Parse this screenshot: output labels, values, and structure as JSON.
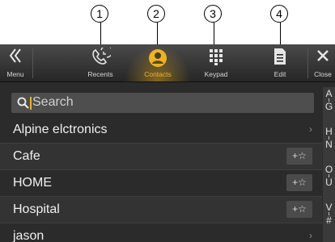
{
  "callouts": [
    "1",
    "2",
    "3",
    "4"
  ],
  "tabs": {
    "menu": {
      "label": "Menu",
      "icon": "double-chevron-left-icon"
    },
    "recents": {
      "label": "Recents",
      "icon": "phone-recents-icon"
    },
    "contacts": {
      "label": "Contacts",
      "icon": "contact-person-icon"
    },
    "keypad": {
      "label": "Keypad",
      "icon": "keypad-icon"
    },
    "edit": {
      "label": "Edit",
      "icon": "document-edit-icon"
    },
    "close": {
      "label": "Close",
      "icon": "close-x-icon"
    }
  },
  "search": {
    "placeholder": "Search"
  },
  "contacts": [
    {
      "name": "Alpine elctronics",
      "action": "›"
    },
    {
      "name": "Cafe",
      "action": "+☆"
    },
    {
      "name": "HOME",
      "action": "+☆"
    },
    {
      "name": "Hospital",
      "action": "+☆"
    },
    {
      "name": "jason",
      "action": "›"
    }
  ],
  "index": [
    {
      "top": "A",
      "bottom": "G"
    },
    {
      "top": "H",
      "bottom": "N"
    },
    {
      "top": "O",
      "bottom": "U"
    },
    {
      "top": "V",
      "bottom": "#"
    }
  ],
  "colors": {
    "accent": "#f1b21a",
    "background": "#2b2b2b"
  }
}
